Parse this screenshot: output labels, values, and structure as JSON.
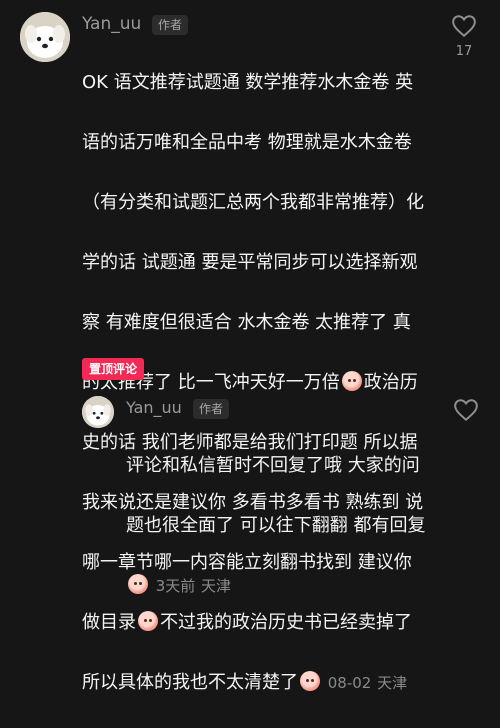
{
  "comment": {
    "author": "Yan_uu",
    "author_badge": "作者",
    "like_count": "17",
    "text_lines": [
      "OK 语文推荐试题通 数学推荐水木金卷 英",
      "语的话万唯和全品中考 物理就是水木金卷",
      "（有分类和试题汇总两个我都非常推荐）化",
      "学的话 试题通 要是平常同步可以选择新观",
      "察 有难度但很适合 水木金卷 太推荐了 真",
      "的太推荐了 比一飞冲天好一万倍",
      "史的话 我们老师都是给我们打印题 所以据",
      "我来说还是建议你 多看书多看书 熟练到 说",
      "哪一章节哪一内容能立刻翻书找到 建议你",
      "做目录",
      "所以具体的我也不太清楚了"
    ],
    "line6_tail": "政治历",
    "line10_tail": "不过我的政治历史书已经卖掉了",
    "date": "08-02",
    "location": "天津",
    "pinned_label": "置顶评论",
    "emoji_name": "crying-face-emoji"
  },
  "reply": {
    "author": "Yan_uu",
    "author_badge": "作者",
    "text_lines": [
      "评论和私信暂时不回复了哦 大家的问",
      "题也很全面了 可以往下翻翻 都有回复"
    ],
    "time": "3天前",
    "location": "天津",
    "emoji_name": "blushing-face-emoji"
  },
  "colors": {
    "background": "#161616",
    "pin_badge": "#f22955",
    "text": "#f4f4f4",
    "meta": "#8a8a8a"
  }
}
